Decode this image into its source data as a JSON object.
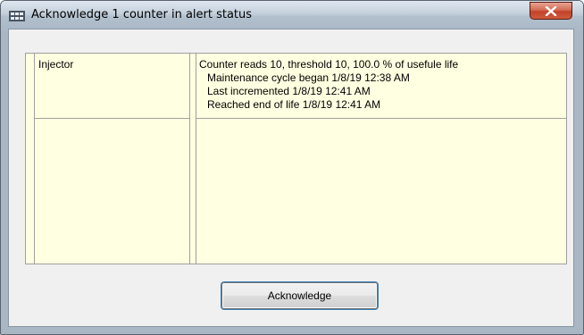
{
  "window": {
    "title": "Acknowledge 1 counter in alert status",
    "close_label": "X"
  },
  "counters": [
    {
      "name": "Injector",
      "details": [
        "Counter reads 10, threshold 10, 100.0 % of usefule life",
        "Maintenance cycle began 1/8/19 12:38 AM",
        "Last incremented 1/8/19 12:41 AM",
        "Reached end of life 1/8/19 12:41 AM"
      ]
    }
  ],
  "footer": {
    "acknowledge_label": "Acknowledge"
  },
  "colors": {
    "grid_background": "#ffffe1",
    "grid_lines": "#a0a0a0",
    "close_button": "#c1432a"
  },
  "icons": [
    "app-icon",
    "close-icon"
  ]
}
